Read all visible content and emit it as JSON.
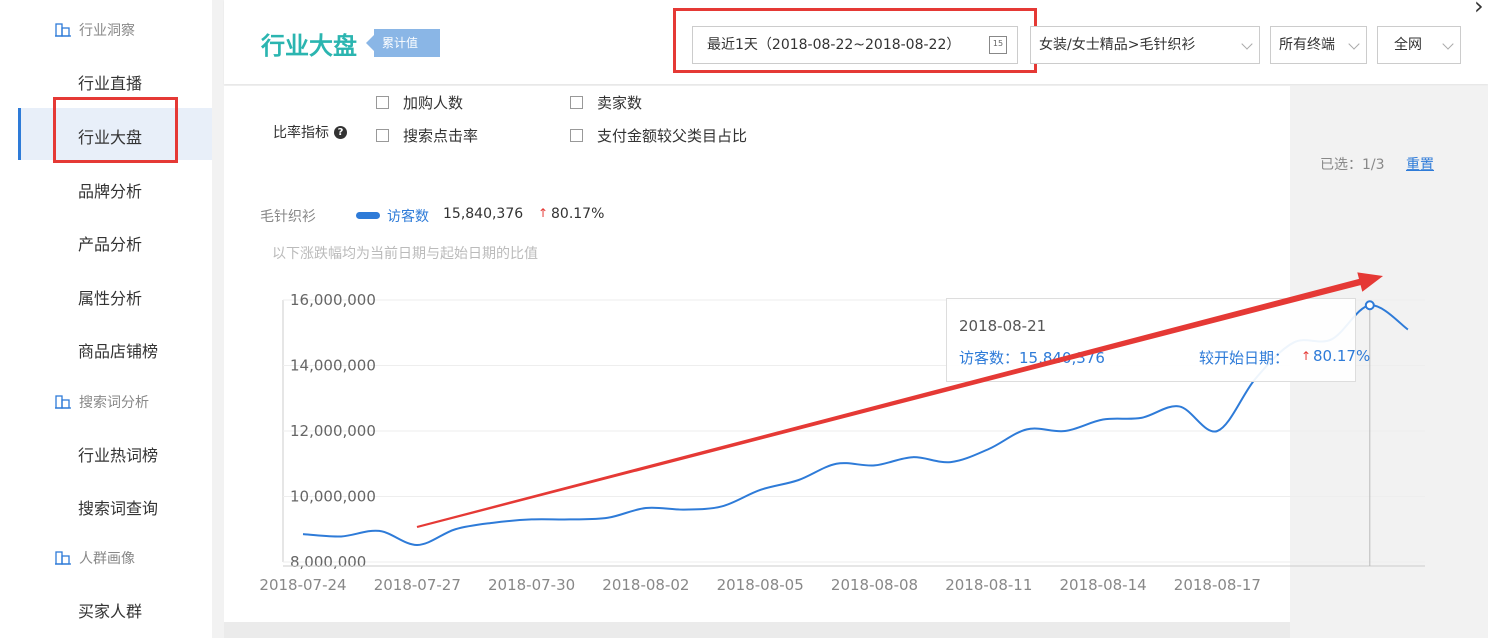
{
  "sidebar": {
    "groups": [
      {
        "label": "行业洞察",
        "items": [
          "行业直播",
          "行业大盘",
          "品牌分析",
          "产品分析",
          "属性分析",
          "商品店铺榜"
        ]
      },
      {
        "label": "搜索词分析",
        "items": [
          "行业热词榜",
          "搜索词查询"
        ]
      },
      {
        "label": "人群画像",
        "items": [
          "买家人群"
        ]
      }
    ],
    "active": "行业大盘"
  },
  "header": {
    "title": "行业大盘",
    "tag": "累计值",
    "date_range": "最近1天（2018-08-22~2018-08-22）",
    "calendar_day": "15",
    "category": "女装/女士精品>毛针织衫",
    "terminal": "所有终端",
    "network": "全网"
  },
  "filters": {
    "label": "比率指标",
    "options": [
      "加购人数",
      "卖家数",
      "搜索点击率",
      "支付金额较父类目占比"
    ],
    "selected_text": "已选：1/3",
    "reset": "重置"
  },
  "legend": {
    "category": "毛针织衫",
    "series": "访客数",
    "value": "15,840,376",
    "arrow": "↑",
    "change": "80.17%"
  },
  "note": "以下涨跌幅均为当前日期与起始日期的比值",
  "tooltip": {
    "date": "2018-08-21",
    "visitors_label": "访客数：15,840,376",
    "compare_label": "较开始日期：",
    "arrow": "↑",
    "compare_value": "80.17%"
  },
  "colors": {
    "accent": "#2e7bd8",
    "title": "#2bb5b0",
    "highlight": "#e53935",
    "trend_arrow": "#e53935"
  },
  "chart_data": {
    "type": "line",
    "ylim": [
      8000000,
      16000000
    ],
    "y_ticks": [
      8000000,
      10000000,
      12000000,
      14000000,
      16000000
    ],
    "y_tick_labels": [
      "8,000,000",
      "10,000,000",
      "12,000,000",
      "14,000,000",
      "16,000,000"
    ],
    "x_tick_labels": [
      "2018-07-24",
      "2018-07-27",
      "2018-07-30",
      "2018-08-02",
      "2018-08-05",
      "2018-08-08",
      "2018-08-11",
      "2018-08-14",
      "2018-08-17"
    ],
    "x": [
      "2018-07-24",
      "2018-07-25",
      "2018-07-26",
      "2018-07-27",
      "2018-07-28",
      "2018-07-29",
      "2018-07-30",
      "2018-07-31",
      "2018-08-01",
      "2018-08-02",
      "2018-08-03",
      "2018-08-04",
      "2018-08-05",
      "2018-08-06",
      "2018-08-07",
      "2018-08-08",
      "2018-08-09",
      "2018-08-10",
      "2018-08-11",
      "2018-08-12",
      "2018-08-13",
      "2018-08-14",
      "2018-08-15",
      "2018-08-16",
      "2018-08-17",
      "2018-08-18",
      "2018-08-19",
      "2018-08-20",
      "2018-08-21",
      "2018-08-22"
    ],
    "series": [
      {
        "name": "访客数",
        "values": [
          8850000,
          8780000,
          8950000,
          8520000,
          9000000,
          9200000,
          9300000,
          9300000,
          9350000,
          9650000,
          9600000,
          9700000,
          10200000,
          10500000,
          11000000,
          10950000,
          11200000,
          11050000,
          11450000,
          12050000,
          12000000,
          12350000,
          12400000,
          12750000,
          12000000,
          13600000,
          14700000,
          14800000,
          15840376,
          15100000
        ]
      }
    ],
    "highlight_point": {
      "x": "2018-08-21",
      "y": 15840376
    },
    "grid": true
  }
}
